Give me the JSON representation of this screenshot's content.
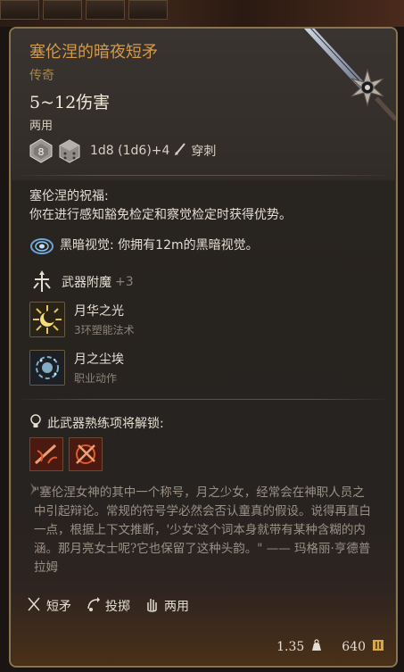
{
  "item": {
    "name": "塞伦涅的暗夜短矛",
    "rarity": "传奇",
    "damage": "5~12伤害",
    "handedness": "两用",
    "dice_label": "8",
    "dice_formula": "1d8 (1d6)+4",
    "damage_type": "穿刺"
  },
  "blessing": {
    "title": "塞伦涅的祝福:",
    "description": "你在进行感知豁免检定和察觉检定时获得优势。"
  },
  "darkvision": {
    "text": "黑暗视觉: 你拥有12m的黑暗视觉。"
  },
  "enchant": {
    "label": "武器附魔",
    "bonus": "+3"
  },
  "actions": [
    {
      "name": "月华之光",
      "subtitle": "3环塑能法术",
      "icon": "moonbeam-icon"
    },
    {
      "name": "月之尘埃",
      "subtitle": "职业动作",
      "icon": "moon-dust-icon"
    }
  ],
  "proficiency": {
    "label": "此武器熟练项将解锁:"
  },
  "quote": "\"塞伦涅女神的其中一个称号，月之少女，经常会在神职人员之中引起辩论。常规的符号学必然会否认童真的假设。说得再直白一点，根据上下文推断，'少女'这个词本身就带有某种含糊的内涵。那月亮女士呢?它也保留了这种头韵。\" —— 玛格丽·亨德普拉姆",
  "properties": [
    {
      "label": "短矛",
      "icon": "spear-icon"
    },
    {
      "label": "投掷",
      "icon": "throw-icon"
    },
    {
      "label": "两用",
      "icon": "hand-icon"
    }
  ],
  "footer": {
    "weight": "1.35",
    "value": "640"
  },
  "colors": {
    "title": "#d49a4a",
    "rarity": "#a08552",
    "border": "#8a7450",
    "bonus": "#8d8377"
  }
}
